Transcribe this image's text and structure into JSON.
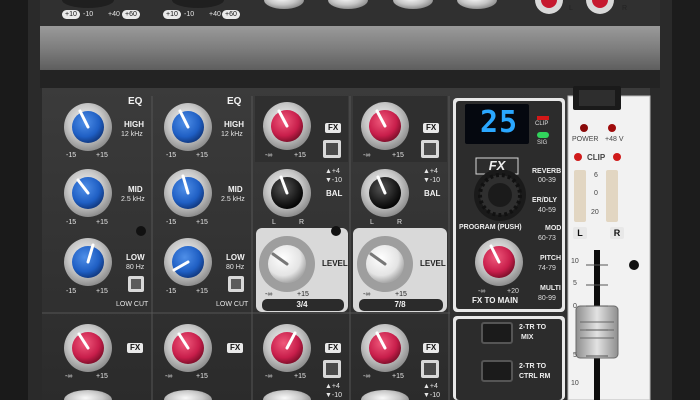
{
  "top": {
    "gain_scale_1": [
      "+10",
      "-10",
      "+40",
      "+60"
    ],
    "gain_scale_2": [
      "+10",
      "-10",
      "+40",
      "+60"
    ],
    "out_left": "L",
    "out_right": "R"
  },
  "channels": [
    {
      "id": "ch1",
      "eq_title": "EQ",
      "high": {
        "label": "HIGH",
        "freq": "12 kHz",
        "min": "-15",
        "max": "+15"
      },
      "mid": {
        "label": "MID",
        "freq": "2.5 kHz",
        "min": "-15",
        "max": "+15"
      },
      "low": {
        "label": "LOW",
        "freq": "80 Hz",
        "min": "-15",
        "max": "+15"
      },
      "low_cut": "LOW CUT",
      "fx_badge": "FX",
      "fx_min": "-∞",
      "fx_max": "+15"
    },
    {
      "id": "ch2",
      "eq_title": "EQ",
      "high": {
        "label": "HIGH",
        "freq": "12 kHz",
        "min": "-15",
        "max": "+15"
      },
      "mid": {
        "label": "MID",
        "freq": "2.5 kHz",
        "min": "-15",
        "max": "+15"
      },
      "low": {
        "label": "LOW",
        "freq": "80 Hz",
        "min": "-15",
        "max": "+15"
      },
      "low_cut": "LOW CUT",
      "fx_badge": "FX",
      "fx_min": "-∞",
      "fx_max": "+15"
    }
  ],
  "stereo_channels": [
    {
      "id": "ch34",
      "fx_badge": "FX",
      "fx_min": "-∞",
      "fx_max": "+15",
      "trim_up": "▲+4",
      "trim_down": "▼-10",
      "bal": "BAL",
      "bal_l": "L",
      "bal_r": "R",
      "level": "LEVEL",
      "level_min": "-∞",
      "level_max": "+15",
      "name": "3/4",
      "lower_fx_badge": "FX",
      "lower_min": "-∞",
      "lower_max": "+15",
      "lower_trim_up": "▲+4",
      "lower_trim_down": "▼-10"
    },
    {
      "id": "ch78",
      "fx_badge": "FX",
      "fx_min": "-∞",
      "fx_max": "+15",
      "trim_up": "▲+4",
      "trim_down": "▼-10",
      "bal": "BAL",
      "bal_l": "L",
      "bal_r": "R",
      "level": "LEVEL",
      "level_min": "-∞",
      "level_max": "+15",
      "name": "7/8",
      "lower_fx_badge": "FX",
      "lower_min": "-∞",
      "lower_max": "+15",
      "lower_trim_up": "▲+4",
      "lower_trim_down": "▼-10"
    }
  ],
  "fx": {
    "display": "25",
    "clip": "CLIP",
    "sig": "SIG",
    "logo": "FX",
    "program_label": "PROGRAM (PUSH)",
    "presets": [
      {
        "name": "REVERB",
        "range": "00-39"
      },
      {
        "name": "ER/DLY",
        "range": "40-59"
      },
      {
        "name": "MOD",
        "range": "60-73"
      },
      {
        "name": "PITCH",
        "range": "74-79"
      },
      {
        "name": "MULTI",
        "range": "80-99"
      }
    ],
    "to_main_label": "FX TO MAIN",
    "to_main_min": "-∞",
    "to_main_max": "+20"
  },
  "routing": {
    "btn1": "2-TR TO MIX",
    "btn1_a": "2-TR TO",
    "btn1_b": "MIX",
    "btn2_a": "2-TR TO",
    "btn2_b": "CTRL RM"
  },
  "master": {
    "power": "POWER",
    "phantom": "+48 V",
    "clip": "CLIP",
    "meter_ticks": [
      "6",
      "0",
      "20"
    ],
    "meter_l": "L",
    "meter_r": "R",
    "fader_ticks": [
      "10",
      "5",
      "0",
      "5",
      "10"
    ]
  }
}
